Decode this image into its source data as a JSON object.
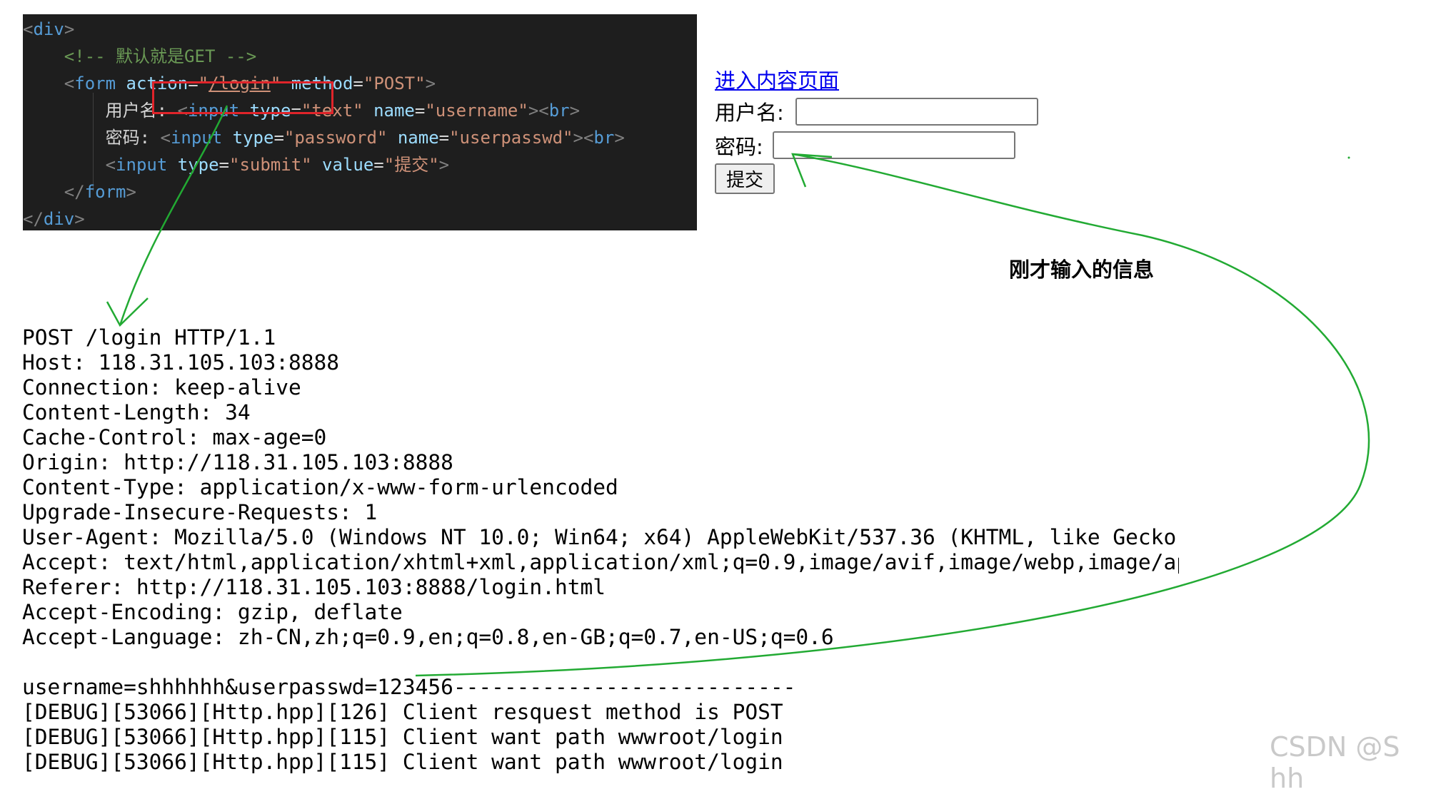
{
  "code": {
    "line1": {
      "open": "<",
      "tag": "div",
      "close": ">"
    },
    "line2": {
      "comment": "<!-- 默认就是GET -->"
    },
    "line3": {
      "open": "<",
      "tag": "form",
      "attr1": "action",
      "eq1": "=",
      "val1_q1": "\"",
      "val1": "/login",
      "val1_q2": "\"",
      "attr2": "method",
      "eq2": "=",
      "val2": "\"POST\"",
      "close": ">"
    },
    "line4": {
      "label": "用户名: ",
      "open": "<",
      "tag": "input",
      "attr1": "type",
      "eq": "=",
      "val1": "\"text\"",
      "attr2": "name",
      "val2": "\"username\"",
      "close": "><",
      "br": "br",
      "end": ">"
    },
    "line5": {
      "label": "密码: ",
      "open": "<",
      "tag": "input",
      "attr1": "type",
      "eq": "=",
      "val1": "\"password\"",
      "attr2": "name",
      "val2": "\"userpasswd\"",
      "close": "><",
      "br": "br",
      "end": ">"
    },
    "line6": {
      "open": "<",
      "tag": "input",
      "attr1": "type",
      "eq": "=",
      "val1": "\"submit\"",
      "attr2": "value",
      "val2": "\"提交\"",
      "close": ">"
    },
    "line7": {
      "open": "</",
      "tag": "form",
      "close": ">"
    },
    "line8": {
      "open": "</",
      "tag": "div",
      "close": ">"
    }
  },
  "form_preview": {
    "link": "进入内容页面",
    "username_label": "用户名:",
    "username_value": "",
    "password_label": "密码:",
    "password_value": "",
    "submit_label": "提交"
  },
  "annotation": "刚才输入的信息",
  "request_lines": [
    "POST /login HTTP/1.1",
    "Host: 118.31.105.103:8888",
    "Connection: keep-alive",
    "Content-Length: 34",
    "Cache-Control: max-age=0",
    "Origin: http://118.31.105.103:8888",
    "Content-Type: application/x-www-form-urlencoded",
    "Upgrade-Insecure-Requests: 1",
    "User-Agent: Mozilla/5.0 (Windows NT 10.0; Win64; x64) AppleWebKit/537.36 (KHTML, like Gecko) Ch",
    "Accept: text/html,application/xhtml+xml,application/xml;q=0.9,image/avif,image/webp,image/apng,",
    "Referer: http://118.31.105.103:8888/login.html",
    "Accept-Encoding: gzip, deflate",
    "Accept-Language: zh-CN,zh;q=0.9,en;q=0.8,en-GB;q=0.7,en-US;q=0.6",
    "",
    "username=shhhhhh&userpasswd=123456---------------------------",
    "[DEBUG][53066][Http.hpp][126] Client resquest method is POST",
    "[DEBUG][53066][Http.hpp][115] Client want path wwwroot/login",
    "[DEBUG][53066][Http.hpp][115] Client want path wwwroot/login"
  ],
  "watermark": "CSDN @S  hh",
  "colors": {
    "arrow": "#22aa33",
    "highlight": "#e0242a",
    "editor_bg": "#1e1e1e",
    "link": "#0000ee"
  }
}
